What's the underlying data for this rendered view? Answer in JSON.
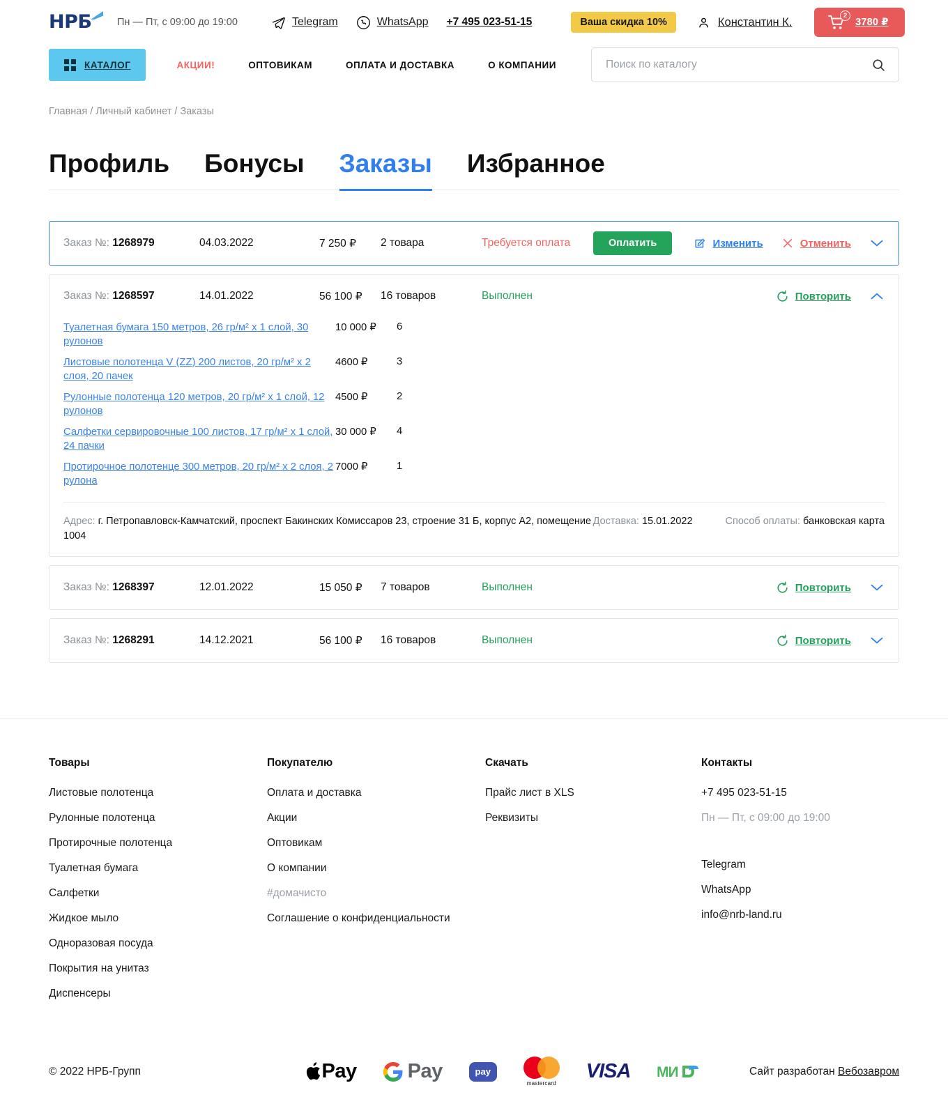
{
  "header": {
    "logo_text": "НРБ",
    "worktime": "Пн — Пт, с 09:00 до 19:00",
    "telegram": "Telegram",
    "whatsapp": "WhatsApp",
    "phone": "+7 495 023-51-15",
    "discount_badge": "Ваша скидка 10%",
    "user_name": "Константин К.",
    "cart_count": "2",
    "cart_sum": "3780 ₽"
  },
  "nav": {
    "catalog": "КАТАЛОГ",
    "links": [
      {
        "label": "АКЦИИ!",
        "accent": true
      },
      {
        "label": "ОПТОВИКАМ",
        "accent": false
      },
      {
        "label": "ОПЛАТА И ДОСТАВКА",
        "accent": false
      },
      {
        "label": "О КОМПАНИИ",
        "accent": false
      }
    ],
    "search_placeholder": "Поиск по каталогу",
    "search_value": ""
  },
  "breadcrumb": {
    "full": "Главная / Личный кабинет / Заказы",
    "items": [
      "Главная",
      "Личный кабинет",
      "Заказы"
    ]
  },
  "tabs": [
    {
      "label": "Профиль",
      "active": false
    },
    {
      "label": "Бонусы",
      "active": false
    },
    {
      "label": "Заказы",
      "active": true
    },
    {
      "label": "Избранное",
      "active": false
    }
  ],
  "labels": {
    "order_no": "Заказ №:",
    "pay_button": "Оплатить",
    "edit": "Изменить",
    "cancel": "Отменить",
    "repeat": "Повторить",
    "address_label": "Адрес:",
    "delivery_label": "Доставка:",
    "payment_label": "Способ оплаты:"
  },
  "orders": [
    {
      "number": "1268979",
      "date": "04.03.2022",
      "sum": "7 250 ₽",
      "items_count": "2 товара",
      "status": "Требуется оплата",
      "status_kind": "warn"
    },
    {
      "number": "1268597",
      "date": "14.01.2022",
      "sum": "56 100 ₽",
      "items_count": "16 товаров",
      "status": "Выполнен",
      "status_kind": "done",
      "products": [
        {
          "name": "Туалетная бумага 150 метров, 26 гр/м² х 1 слой, 30 рулонов",
          "sum": "10 000 ₽",
          "qty": "6"
        },
        {
          "name": "Листовые полотенца V (ZZ) 200 листов, 20 гр/м² х 2 слоя, 20 пачек",
          "sum": "4600 ₽",
          "qty": "3"
        },
        {
          "name": "Рулонные полотенца 120 метров, 20 гр/м² х 1 слой, 12 рулонов",
          "sum": "4500 ₽",
          "qty": "2"
        },
        {
          "name": "Салфетки сервировочные 100 листов, 17 гр/м² х 1 слой, 24 пачки",
          "sum": "30 000 ₽",
          "qty": "4"
        },
        {
          "name": "Протирочное полотенце 300 метров, 20 гр/м² х 2 слоя, 2 рулона",
          "sum": "7000 ₽",
          "qty": "1"
        }
      ],
      "address": "г. Петропавловск-Камчатский, проспект Бакинских Комиссаров 23, строение 31 Б, корпус А2, помещение 1004",
      "delivery_date": "15.01.2022",
      "payment_method": "банковская карта"
    },
    {
      "number": "1268397",
      "date": "12.01.2022",
      "sum": "15 050 ₽",
      "items_count": "7 товаров",
      "status": "Выполнен",
      "status_kind": "done"
    },
    {
      "number": "1268291",
      "date": "14.12.2021",
      "sum": "56 100 ₽",
      "items_count": "16 товаров",
      "status": "Выполнен",
      "status_kind": "done"
    }
  ],
  "footer": {
    "columns": [
      {
        "title": "Товары",
        "links": [
          "Листовые полотенца",
          "Рулонные полотенца",
          "Протирочные полотенца",
          "Туалетная бумага",
          "Салфетки",
          "Жидкое мыло",
          "Одноразовая посуда",
          "Покрытия на унитаз",
          "Диспенсеры"
        ]
      },
      {
        "title": "Покупателю",
        "links": [
          "Оплата и доставка",
          "Акции",
          "Оптовикам",
          "О компании",
          "#домачисто",
          "Соглашение о конфиденциальности"
        ]
      },
      {
        "title": "Скачать",
        "links": [
          "Прайс лист в XLS",
          "Реквизиты"
        ]
      },
      {
        "title": "Контакты",
        "phone": "+7 495 023-51-15",
        "worktime": "Пн — Пт, с 09:00 до 19:00",
        "links": [
          "Telegram",
          "WhatsApp",
          "info@nrb-land.ru"
        ]
      }
    ],
    "copyright": "© 2022 НРБ-Групп",
    "developed_prefix": "Сайт разработан ",
    "developed_by": "Вебозавром",
    "payment_logos": [
      "Apple Pay",
      "G Pay",
      "pay",
      "mastercard",
      "VISA",
      "МИР"
    ]
  },
  "colors": {
    "accent_blue": "#2f7ff0",
    "catalog_cyan": "#5cc8ee",
    "red": "#f2635f",
    "green": "#23a05a",
    "pay_green": "#24a35a",
    "yellow": "#f3c948",
    "cart_red": "#e85a5a"
  }
}
